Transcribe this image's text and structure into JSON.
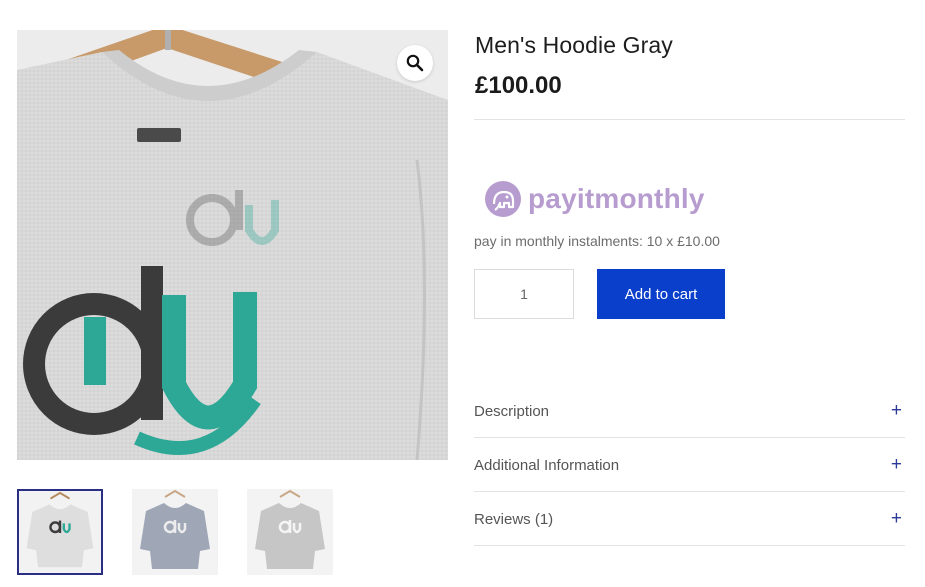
{
  "product": {
    "title": "Men's Hoodie Gray",
    "price": "£100.00"
  },
  "gallery": {
    "zoom_icon": "magnifier-icon",
    "thumbnails": [
      {
        "label": "Gray hoodie on hanger",
        "color": "#e6e6e6",
        "active": true
      },
      {
        "label": "Blue-gray hoodie",
        "color": "#8a94a8",
        "active": false
      },
      {
        "label": "Light gray hoodie",
        "color": "#b9b9b9",
        "active": false
      }
    ]
  },
  "payitmonthly": {
    "logo_text": "payitmonthly",
    "instalment_text": "pay in monthly instalments: 10 x £10.00"
  },
  "cart": {
    "quantity": "1",
    "add_to_cart_label": "Add to cart"
  },
  "tabs": [
    {
      "label": "Description",
      "icon": "plus-icon"
    },
    {
      "label": "Additional Information",
      "icon": "plus-icon"
    },
    {
      "label": "Reviews (1)",
      "icon": "plus-icon"
    }
  ],
  "colors": {
    "accent": "#0a3fcc",
    "brand_pim": "#b79ccf",
    "logo_teal": "#2ea896",
    "logo_dark": "#3b3b3b"
  }
}
